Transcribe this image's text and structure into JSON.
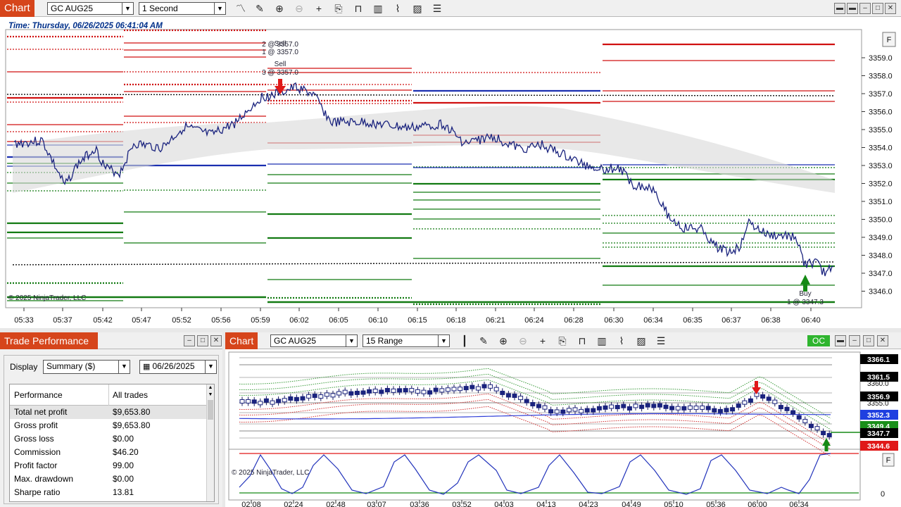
{
  "top_chart": {
    "tag": "Chart",
    "instrument": "GC AUG25",
    "interval": "1 Second",
    "time_label": "Time: Thursday, 06/26/2025 06:41:04 AM",
    "copyright": "© 2025 NinjaTrader, LLC",
    "f_button": "F",
    "price_ticks": [
      "3359.0",
      "3358.0",
      "3357.0",
      "3356.0",
      "3355.0",
      "3354.0",
      "3353.0",
      "3352.0",
      "3351.0",
      "3350.0",
      "3349.0",
      "3348.0",
      "3347.0",
      "3346.0"
    ],
    "time_ticks": [
      "05:33",
      "05:37",
      "05:42",
      "05:47",
      "05:52",
      "05:56",
      "05:59",
      "06:02",
      "06:05",
      "06:10",
      "06:15",
      "06:18",
      "06:21",
      "06:24",
      "06:28",
      "06:30",
      "06:34",
      "06:35",
      "06:37",
      "06:38",
      "06:40"
    ],
    "annotations": {
      "sell_top": "2 @ 3357.0",
      "sell_1_label": "Sell",
      "sell_1_fill": "1 @ 3357.0",
      "sell_2_label": "Sell",
      "sell_2_fill": "3 @ 3357.0",
      "buy_label": "Buy",
      "buy_fill": "1 @ 3347.3"
    }
  },
  "trade_performance": {
    "tag": "Trade Performance",
    "display_label": "Display",
    "display_value": "Summary ($)",
    "date_value": "06/26/2025",
    "col_performance": "Performance",
    "col_all_trades": "All trades",
    "rows": [
      {
        "name": "Total net profit",
        "value": "$9,653.80"
      },
      {
        "name": "Gross profit",
        "value": "$9,653.80"
      },
      {
        "name": "Gross loss",
        "value": "$0.00"
      },
      {
        "name": "Commission",
        "value": "$46.20"
      },
      {
        "name": "Profit factor",
        "value": "99.00"
      },
      {
        "name": "Max. drawdown",
        "value": "$0.00"
      },
      {
        "name": "Sharpe ratio",
        "value": "13.81"
      }
    ]
  },
  "bottom_chart": {
    "tag": "Chart",
    "instrument": "GC AUG25",
    "interval": "15 Range",
    "oc_button": "OC",
    "copyright": "© 2025 NinjaTrader, LLC",
    "f_button": "F",
    "price_badges": [
      {
        "label": "3366.1",
        "color": "#000000"
      },
      {
        "label": "3361.5",
        "color": "#000000"
      },
      {
        "label": "3356.9",
        "color": "#000000"
      },
      {
        "label": "3352.3",
        "color": "#1f3fe0"
      },
      {
        "label": "3349.4",
        "color": "#1a8f1a"
      },
      {
        "label": "3347.7",
        "color": "#000000"
      },
      {
        "label": "3344.6",
        "color": "#e01818"
      }
    ],
    "hidden_labels": [
      "3360.0",
      "3355.0"
    ],
    "osc_label": "0",
    "time_ticks": [
      "02:08",
      "02:24",
      "02:48",
      "03:07",
      "03:36",
      "03:52",
      "04:03",
      "04:13",
      "04:23",
      "04:49",
      "05:10",
      "05:36",
      "06:00",
      "06:34"
    ]
  }
}
